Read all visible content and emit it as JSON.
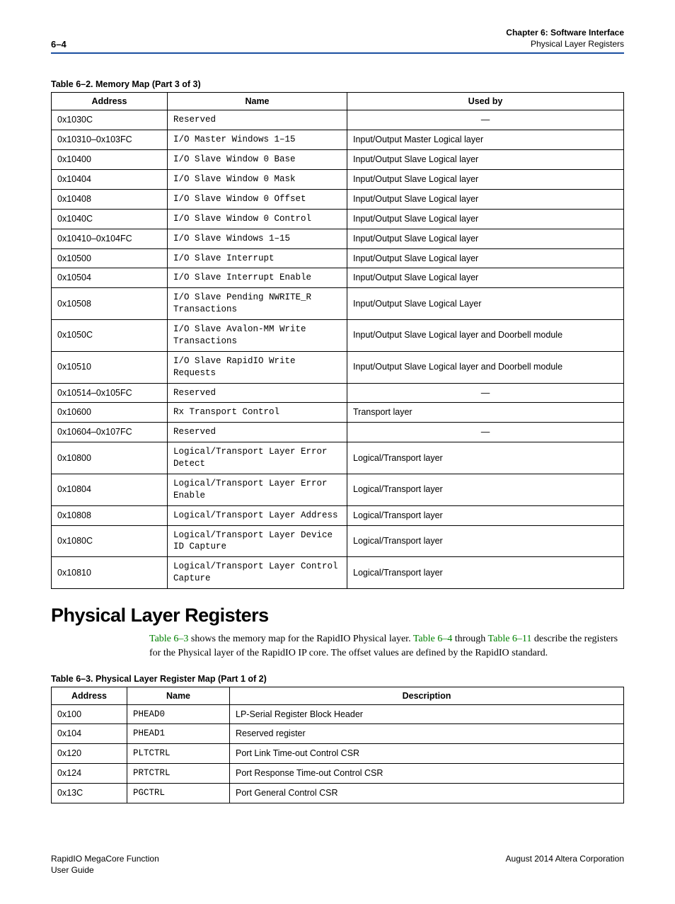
{
  "header": {
    "page": "6–4",
    "chapter": "Chapter 6:  Software Interface",
    "section": "Physical Layer Registers"
  },
  "table1": {
    "caption": "Table 6–2.  Memory Map  (Part 3 of 3)",
    "headers": {
      "address": "Address",
      "name": "Name",
      "usedby": "Used by"
    },
    "rows": [
      {
        "address": "0x1030C",
        "name": "Reserved",
        "usedby": "—",
        "center": true
      },
      {
        "address": "0x10310–0x103FC",
        "name": "I/O Master Windows 1–15",
        "usedby": "Input/Output Master Logical layer"
      },
      {
        "address": "0x10400",
        "name": "I/O Slave Window 0 Base",
        "usedby": "Input/Output Slave Logical layer"
      },
      {
        "address": "0x10404",
        "name": "I/O Slave Window 0 Mask",
        "usedby": "Input/Output Slave Logical layer"
      },
      {
        "address": "0x10408",
        "name": "I/O Slave Window 0 Offset",
        "usedby": "Input/Output Slave Logical layer"
      },
      {
        "address": "0x1040C",
        "name": "I/O Slave Window 0 Control",
        "usedby": "Input/Output Slave Logical layer"
      },
      {
        "address": "0x10410–0x104FC",
        "name": "I/O Slave Windows 1–15",
        "usedby": "Input/Output Slave Logical layer"
      },
      {
        "address": "0x10500",
        "name": "I/O Slave Interrupt",
        "usedby": "Input/Output Slave Logical layer"
      },
      {
        "address": "0x10504",
        "name": "I/O Slave Interrupt Enable",
        "usedby": "Input/Output Slave Logical layer"
      },
      {
        "address": "0x10508",
        "name": "I/O Slave Pending NWRITE_R Transactions",
        "usedby": "Input/Output Slave Logical Layer"
      },
      {
        "address": "0x1050C",
        "name": "I/O Slave Avalon-MM Write Transactions",
        "usedby": "Input/Output Slave Logical layer and Doorbell module"
      },
      {
        "address": "0x10510",
        "name": "I/O Slave RapidIO Write Requests",
        "usedby": "Input/Output Slave Logical layer and Doorbell module"
      },
      {
        "address": "0x10514–0x105FC",
        "name": "Reserved",
        "usedby": "—",
        "center": true
      },
      {
        "address": "0x10600",
        "name": "Rx Transport Control",
        "usedby": "Transport layer"
      },
      {
        "address": "0x10604–0x107FC",
        "name": "Reserved",
        "usedby": "—",
        "center": true
      },
      {
        "address": "0x10800",
        "name": "Logical/Transport Layer Error Detect",
        "usedby": "Logical/Transport layer"
      },
      {
        "address": "0x10804",
        "name": "Logical/Transport Layer Error Enable",
        "usedby": "Logical/Transport layer"
      },
      {
        "address": "0x10808",
        "name": "Logical/Transport Layer Address",
        "usedby": "Logical/Transport layer"
      },
      {
        "address": "0x1080C",
        "name": "Logical/Transport Layer Device ID Capture",
        "usedby": "Logical/Transport layer"
      },
      {
        "address": "0x10810",
        "name": "Logical/Transport Layer Control Capture",
        "usedby": "Logical/Transport layer"
      }
    ]
  },
  "section_heading": "Physical Layer Registers",
  "body": {
    "link1": "Table 6–3",
    "text1": " shows the memory map for the RapidIO Physical layer. ",
    "link2": "Table 6–4",
    "text2": " through ",
    "link3": "Table 6–11",
    "text3": " describe the registers for the Physical layer of the RapidIO IP core. The offset values are defined by the RapidIO standard."
  },
  "table2": {
    "caption": "Table 6–3.  Physical Layer Register Map  (Part 1 of 2)",
    "headers": {
      "address": "Address",
      "name": "Name",
      "description": "Description"
    },
    "rows": [
      {
        "address": "0x100",
        "name": "PHEAD0",
        "description": "LP-Serial Register Block Header"
      },
      {
        "address": "0x104",
        "name": "PHEAD1",
        "description": "Reserved register"
      },
      {
        "address": "0x120",
        "name": "PLTCTRL",
        "description": "Port Link Time-out Control CSR"
      },
      {
        "address": "0x124",
        "name": "PRTCTRL",
        "description": "Port Response Time-out Control CSR"
      },
      {
        "address": "0x13C",
        "name": "PGCTRL",
        "description": "Port General Control CSR"
      }
    ]
  },
  "footer": {
    "left1": "RapidIO MegaCore Function",
    "left2": "User Guide",
    "right": "August 2014   Altera Corporation"
  }
}
